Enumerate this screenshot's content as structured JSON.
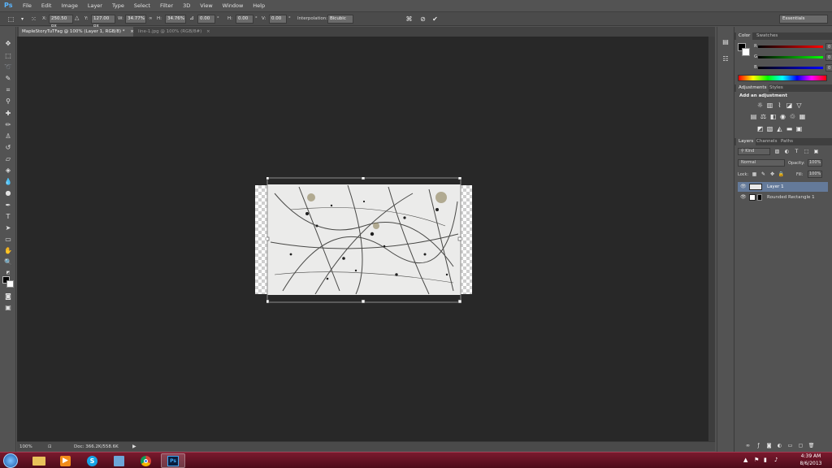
{
  "app": {
    "logo": "Ps",
    "menu": [
      "File",
      "Edit",
      "Image",
      "Layer",
      "Type",
      "Select",
      "Filter",
      "3D",
      "View",
      "Window",
      "Help"
    ]
  },
  "options_bar": {
    "x_label": "X:",
    "x_value": "250.50 px",
    "y_label": "Y:",
    "y_value": "127.00 px",
    "w_label": "W:",
    "w_value": "34.77%",
    "h_label": "H:",
    "h_value": "34.76%",
    "angle_value": "0.00",
    "hskew_label": "H:",
    "hskew_value": "0.00",
    "vskew_label": "V:",
    "vskew_value": "0.00",
    "interp_label": "Interpolation:",
    "interp_value": "Bicubic",
    "workspace": "Essentials"
  },
  "documents": {
    "tabs": [
      {
        "label": "MapleStoryTuTFag @ 100% (Layer 1, RGB/8) *",
        "active": true
      },
      {
        "label": "line-1.jpg @ 100% (RGB/8#)",
        "active": false
      }
    ]
  },
  "status": {
    "zoom": "100%",
    "doc": "Doc: 366.2K/558.6K"
  },
  "color_panel": {
    "tabs": [
      "Color",
      "Swatches"
    ],
    "channels": [
      {
        "label": "R",
        "value": "0",
        "color": "#ff0000"
      },
      {
        "label": "G",
        "value": "0",
        "color": "#00ff00"
      },
      {
        "label": "B",
        "value": "0",
        "color": "#0000ff"
      }
    ]
  },
  "adjustments_panel": {
    "tabs": [
      "Adjustments",
      "Styles"
    ],
    "heading": "Add an adjustment"
  },
  "layers_panel": {
    "tabs": [
      "Layers",
      "Channels",
      "Paths"
    ],
    "kind": "Kind",
    "blend": "Normal",
    "opacity_label": "Opacity:",
    "opacity_value": "100%",
    "lock_label": "Lock:",
    "fill_label": "Fill:",
    "fill_value": "100%",
    "layers": [
      {
        "name": "Layer 1",
        "selected": true
      },
      {
        "name": "Rounded Rectangle 1",
        "selected": false
      }
    ]
  },
  "taskbar": {
    "time": "4:39 AM",
    "date": "8/6/2013",
    "apps": [
      "start-orb-icon",
      "file-explorer-icon",
      "media-player-icon",
      "skype-icon",
      "notepad-icon",
      "chrome-icon",
      "photoshop-icon"
    ]
  }
}
